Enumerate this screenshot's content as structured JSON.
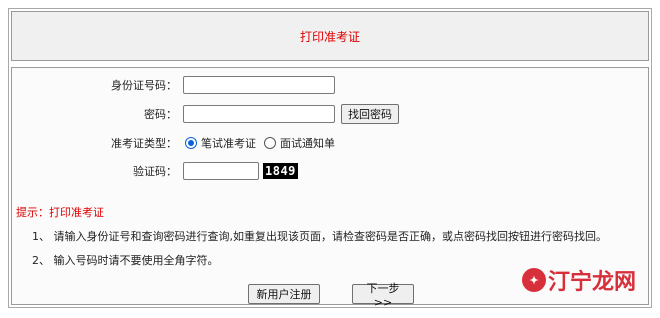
{
  "header": {
    "title": "打印准考证"
  },
  "form": {
    "id_label": "身份证号码：",
    "id_value": "",
    "password_label": "密码：",
    "password_value": "",
    "find_password_button": "找回密码",
    "type_label": "准考证类型：",
    "type_options": [
      {
        "label": "笔试准考证",
        "selected": true
      },
      {
        "label": "面试通知单",
        "selected": false
      }
    ],
    "captcha_label": "验证码：",
    "captcha_value": "",
    "captcha_image_text": "1849"
  },
  "tips": {
    "title": "提示：打印准考证",
    "lines": [
      "1、 请输入身份证号和查询密码进行查询,如重复出现该页面，请检查密码是否正确，或点密码找回按钮进行密码找回。",
      "2、 输入号码时请不要使用全角字符。"
    ]
  },
  "actions": {
    "register_button": "新用户注册",
    "next_button": "下一步>>"
  },
  "watermark": {
    "text": "汀宁龙网",
    "accent": "#d7303a"
  },
  "colors": {
    "title_red": "#e00000",
    "radio_blue": "#0b62d6"
  }
}
